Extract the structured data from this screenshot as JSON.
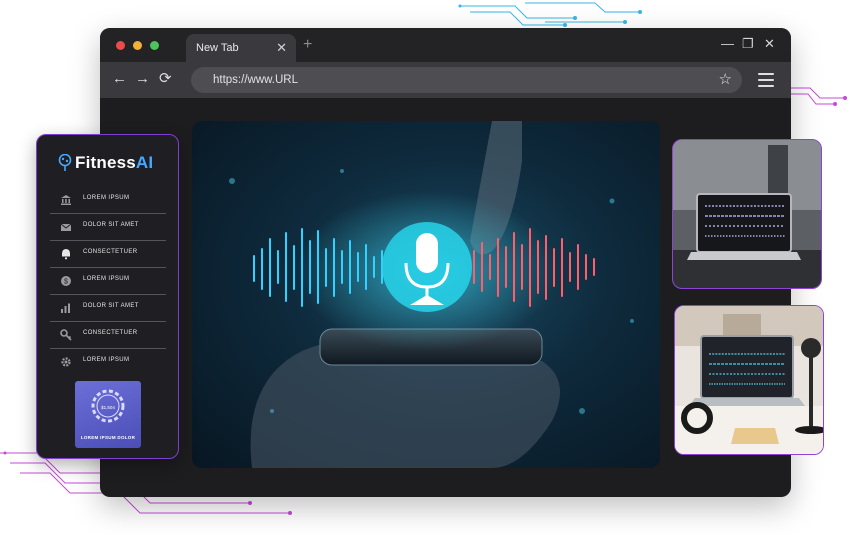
{
  "browser": {
    "tab_title": "New Tab",
    "tab_close": "✕",
    "new_tab": "+",
    "url": "https://www.URL",
    "back": "←",
    "forward": "→",
    "reload": "⟳",
    "star": "☆",
    "minimize": "—",
    "restore": "❐",
    "close": "✕"
  },
  "sidebar": {
    "logo_main": "Fitness",
    "logo_accent": "AI",
    "items": [
      {
        "label": "LOREM IPSUM",
        "icon": "bank-icon"
      },
      {
        "label": "DOLOR SIT AMET",
        "icon": "mail-icon"
      },
      {
        "label": "CONSECTETUER",
        "icon": "bell-icon"
      },
      {
        "label": "LOREM IPSUM",
        "icon": "dollar-icon"
      },
      {
        "label": "DOLOR SIT AMET",
        "icon": "bar-chart-icon"
      },
      {
        "label": "CONSECTETUER",
        "icon": "key-icon"
      },
      {
        "label": "LOREM IPSUM",
        "icon": "gear-icon"
      }
    ],
    "promo_amount": "$1,504",
    "promo_label": "LOREM IPSUM DOLOR"
  },
  "colors": {
    "accent_purple": "#7f3fd1",
    "logo_blue": "#47a8ff",
    "wave_blue": "#2fd3ff",
    "wave_red": "#ff5e6b"
  }
}
